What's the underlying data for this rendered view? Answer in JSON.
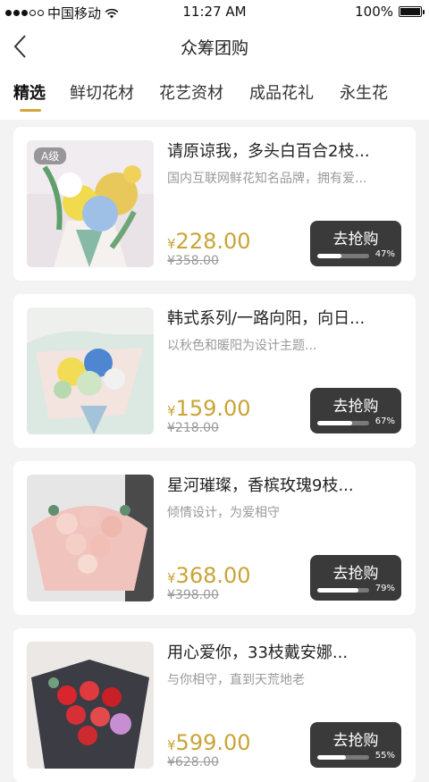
{
  "status_bar": {
    "carrier": "中国移动",
    "time": "11:27 AM",
    "battery": "100%"
  },
  "nav": {
    "title": "众筹团购"
  },
  "tabs": [
    {
      "label": "精选",
      "active": true
    },
    {
      "label": "鲜切花材",
      "active": false
    },
    {
      "label": "花艺资材",
      "active": false
    },
    {
      "label": "成品花礼",
      "active": false
    },
    {
      "label": "永生花",
      "active": false
    }
  ],
  "products": [
    {
      "grade": "A级",
      "title": "请原谅我，多头白百合2枝...",
      "subtitle": "国内互联网鲜花知名品牌，拥有爱...",
      "currency": "¥",
      "price": "228.00",
      "old_price": "¥358.00",
      "button": "去抢购",
      "progress_label": "47%",
      "progress": 0.47
    },
    {
      "grade": "",
      "title": "韩式系列/一路向阳，向日...",
      "subtitle": "以秋色和暖阳为设计主题...",
      "currency": "¥",
      "price": "159.00",
      "old_price": "¥218.00",
      "button": "去抢购",
      "progress_label": "67%",
      "progress": 0.67
    },
    {
      "grade": "",
      "title": "星河璀璨，香槟玫瑰9枝...",
      "subtitle": "倾情设计，为爱相守",
      "currency": "¥",
      "price": "368.00",
      "old_price": "¥398.00",
      "button": "去抢购",
      "progress_label": "79%",
      "progress": 0.79
    },
    {
      "grade": "",
      "title": "用心爱你，33枝戴安娜...",
      "subtitle": "与你相守，直到天荒地老",
      "currency": "¥",
      "price": "599.00",
      "old_price": "¥628.00",
      "button": "去抢购",
      "progress_label": "55%",
      "progress": 0.55
    }
  ],
  "colors": {
    "accent": "#c9a437",
    "tab_underline": "#d4a63c",
    "button_bg": "#3a3a3a",
    "page_bg": "#f3f3f3"
  }
}
